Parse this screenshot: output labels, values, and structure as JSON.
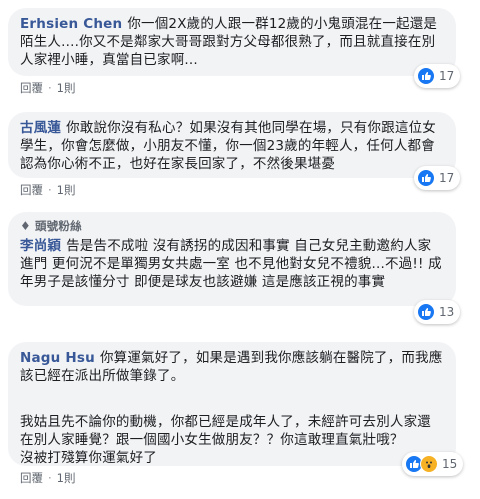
{
  "actions": {
    "reply_label": "回覆",
    "reply_count_label": "1則"
  },
  "comments": [
    {
      "author": "Erhsien Chen",
      "lines": [
        "你一個2X歲的人跟一群12歲的小鬼頭混在一起還是陌生人....你又不是鄰家大哥哥跟對方父母都很熟了，而且就直接在別人家裡小睡，真當自已家啊..."
      ],
      "reaction_count": "17",
      "reactions": [
        "like-icon"
      ]
    },
    {
      "author": "古風蓮",
      "lines": [
        "你敢說你沒有私心？如果沒有其他同學在場，只有你跟這位女學生，你會怎麼做，小朋友不懂，你一個23歲的年輕人，任何人都會認為你心術不正，也好在家長回家了，不然後果堪憂"
      ],
      "reaction_count": "17",
      "reactions": [
        "like-icon"
      ]
    },
    {
      "badge": "頭號粉絲",
      "author": "李尚穎",
      "lines": [
        "告是告不成啦 沒有誘拐的成因和事實 自己女兒主動邀約人家進門 更何況不是單獨男女共處一室 也不見他對女兒不禮貌...不過!! 成年男子是該懂分寸 即便是球友也該避嫌 這是應該正視的事實"
      ],
      "reaction_count": "13",
      "reactions": [
        "like-icon"
      ]
    },
    {
      "author": "Nagu Hsu",
      "lines": [
        "你算運氣好了，如果是遇到我你應該躺在醫院了，而我應該已經在派出所做筆錄了。",
        "我姑且先不論你的動機，你都已經是成年人了，未經許可去別人家還在別人家睡覺？跟一個國小女生做朋友？？你這敢理直氣壯哦？\n沒被打殘算你運氣好了"
      ],
      "reaction_count": "15",
      "reactions": [
        "like-icon",
        "wow-icon"
      ]
    }
  ]
}
